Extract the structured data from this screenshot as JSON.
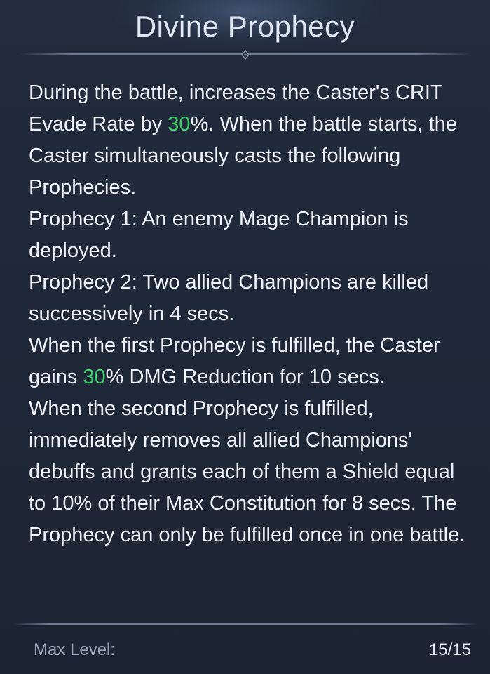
{
  "skill": {
    "title": "Divine Prophecy",
    "highlight_color": "#3fd06a",
    "description": {
      "p1_a": "During the battle, increases the Caster's CRIT Evade Rate by ",
      "p1_hl": "30",
      "p1_b": "%. When the battle starts, the Caster simultaneously casts the following Prophecies.",
      "p2": "Prophecy 1: An enemy Mage Champion is deployed.",
      "p3": "Prophecy 2: Two allied Champions are killed successively in 4 secs.",
      "p4_a": "When the first Prophecy is fulfilled, the Caster gains ",
      "p4_hl": "30",
      "p4_b": "% DMG Reduction for 10 secs.",
      "p5": "When the second Prophecy is fulfilled, immediately removes all allied Champions' debuffs and grants each of them a Shield equal to 10% of their Max Constitution for 8 secs. The Prophecy can only be fulfilled once in one battle."
    },
    "footer": {
      "label": "Max Level:",
      "value": "15/15"
    }
  }
}
